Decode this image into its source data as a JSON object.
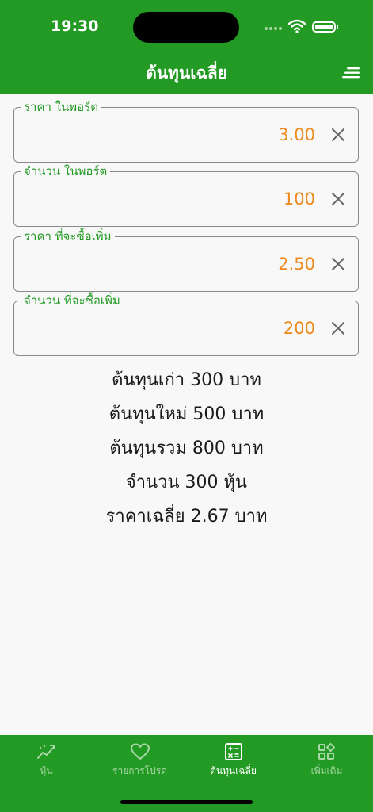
{
  "status_bar": {
    "time": "19:30"
  },
  "header": {
    "title": "ต้นทุนเฉลี่ย"
  },
  "fields": [
    {
      "label": "ราคา ในพอร์ต",
      "value": "3.00"
    },
    {
      "label": "จำนวน ในพอร์ต",
      "value": "100"
    },
    {
      "label": "ราคา ที่จะซื้อเพิ่ม",
      "value": "2.50"
    },
    {
      "label": "จำนวน ที่จะซื้อเพิ่ม",
      "value": "200"
    }
  ],
  "results": [
    "ต้นทุนเก่า  300  บาท",
    "ต้นทุนใหม่  500  บาท",
    "ต้นทุนรวม  800  บาท",
    "จำนวน  300  หุ้น",
    "ราคาเฉลี่ย  2.67  บาท"
  ],
  "tabs": [
    {
      "label": "หุ้น",
      "icon": "trend-chart-icon"
    },
    {
      "label": "รายการโปรด",
      "icon": "heart-icon"
    },
    {
      "label": "ต้นทุนเฉลี่ย",
      "icon": "calculator-icon"
    },
    {
      "label": "เพิ่มเติม",
      "icon": "apps-grid-icon"
    }
  ],
  "colors": {
    "brand": "#229a23",
    "value": "#ee8a1e"
  }
}
